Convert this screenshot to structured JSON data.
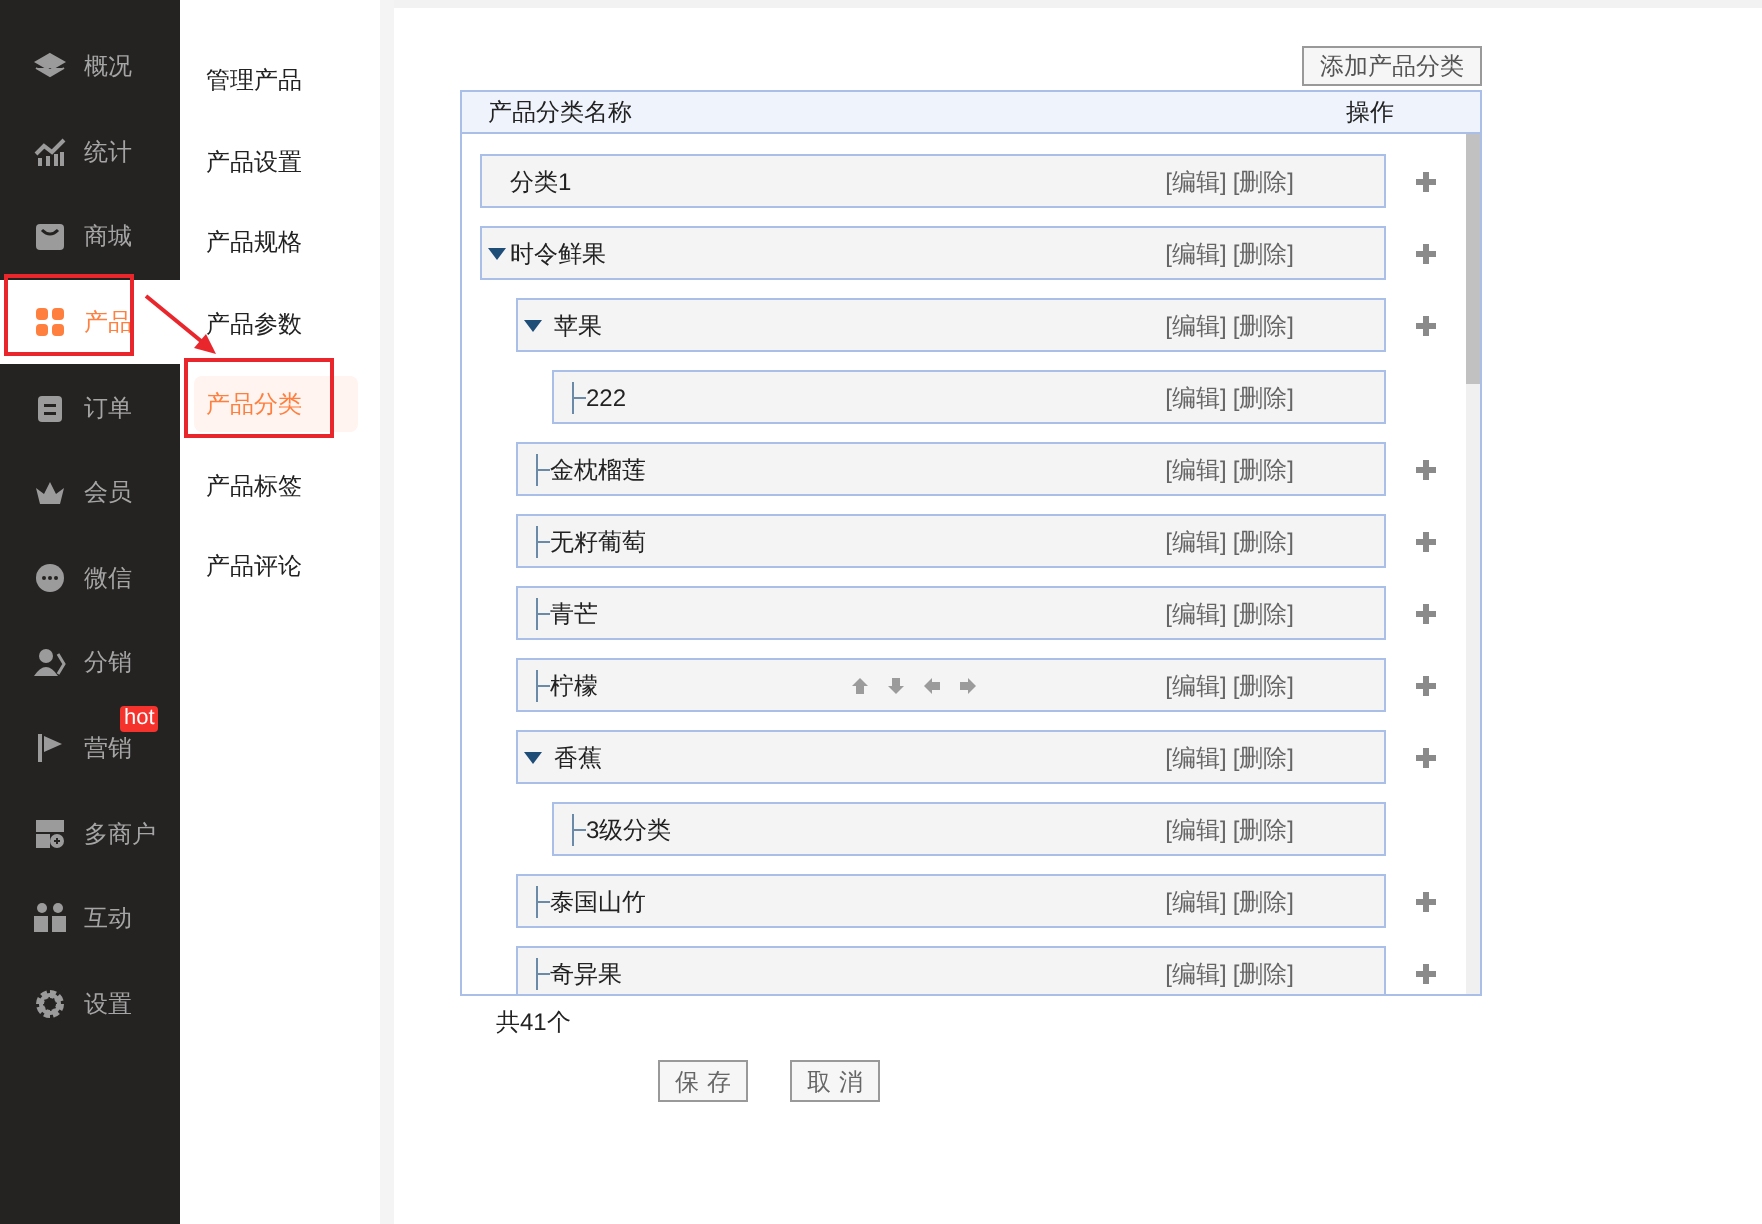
{
  "sidebar": {
    "items": [
      {
        "label": "概况",
        "selected": false,
        "highlighted": false
      },
      {
        "label": "统计",
        "selected": false,
        "highlighted": false
      },
      {
        "label": "商城",
        "selected": false,
        "highlighted": false
      },
      {
        "label": "产品",
        "selected": true,
        "highlighted": true
      },
      {
        "label": "订单",
        "selected": false,
        "highlighted": false
      },
      {
        "label": "会员",
        "selected": false,
        "highlighted": false
      },
      {
        "label": "微信",
        "selected": false,
        "highlighted": false
      },
      {
        "label": "分销",
        "selected": false,
        "highlighted": false
      },
      {
        "label": "营销",
        "selected": false,
        "highlighted": false,
        "badge": "hot"
      },
      {
        "label": "多商户",
        "selected": false,
        "highlighted": false
      },
      {
        "label": "互动",
        "selected": false,
        "highlighted": false
      },
      {
        "label": "设置",
        "selected": false,
        "highlighted": false
      }
    ]
  },
  "submenu": {
    "items": [
      {
        "label": "管理产品",
        "selected": false,
        "highlighted": false
      },
      {
        "label": "产品设置",
        "selected": false,
        "highlighted": false
      },
      {
        "label": "产品规格",
        "selected": false,
        "highlighted": false
      },
      {
        "label": "产品参数",
        "selected": false,
        "highlighted": false
      },
      {
        "label": "产品分类",
        "selected": true,
        "highlighted": true
      },
      {
        "label": "产品标签",
        "selected": false,
        "highlighted": false
      },
      {
        "label": "产品评论",
        "selected": false,
        "highlighted": false
      }
    ]
  },
  "add_button": "添加产品分类",
  "tree": {
    "columns": [
      "产品分类名称",
      "操作"
    ],
    "items": [
      {
        "name": "分类1",
        "hovered": false,
        "actions": [
          "[编辑]",
          "[删除]"
        ]
      },
      {
        "name": "时令鲜果",
        "hovered": false,
        "expanded": true,
        "actions": [
          "[编辑]",
          "[删除]"
        ],
        "children": [
          {
            "name": "苹果",
            "hovered": false,
            "expanded": true,
            "actions": [
              "[编辑]",
              "[删除]"
            ],
            "children": [
              {
                "name": "222",
                "hovered": false,
                "actions": [
                  "[编辑]",
                  "[删除]"
                ]
              }
            ]
          },
          {
            "name": "金枕榴莲",
            "hovered": false,
            "actions": [
              "[编辑]",
              "[删除]"
            ]
          },
          {
            "name": "无籽葡萄",
            "hovered": false,
            "actions": [
              "[编辑]",
              "[删除]"
            ]
          },
          {
            "name": "青芒",
            "hovered": false,
            "actions": [
              "[编辑]",
              "[删除]"
            ]
          },
          {
            "name": "柠檬",
            "hovered": true,
            "actions": [
              "[编辑]",
              "[删除]"
            ]
          },
          {
            "name": "香蕉",
            "hovered": false,
            "expanded": true,
            "actions": [
              "[编辑]",
              "[删除]"
            ],
            "children": [
              {
                "name": "3级分类",
                "hovered": false,
                "actions": [
                  "[编辑]",
                  "[删除]"
                ]
              }
            ]
          },
          {
            "name": "泰国山竹",
            "hovered": false,
            "actions": [
              "[编辑]",
              "[删除]"
            ]
          },
          {
            "name": "奇异果",
            "hovered": false,
            "actions": [
              "[编辑]",
              "[删除]"
            ]
          }
        ]
      }
    ]
  },
  "total": "共41个",
  "buttons": [
    "保存",
    "取消"
  ]
}
